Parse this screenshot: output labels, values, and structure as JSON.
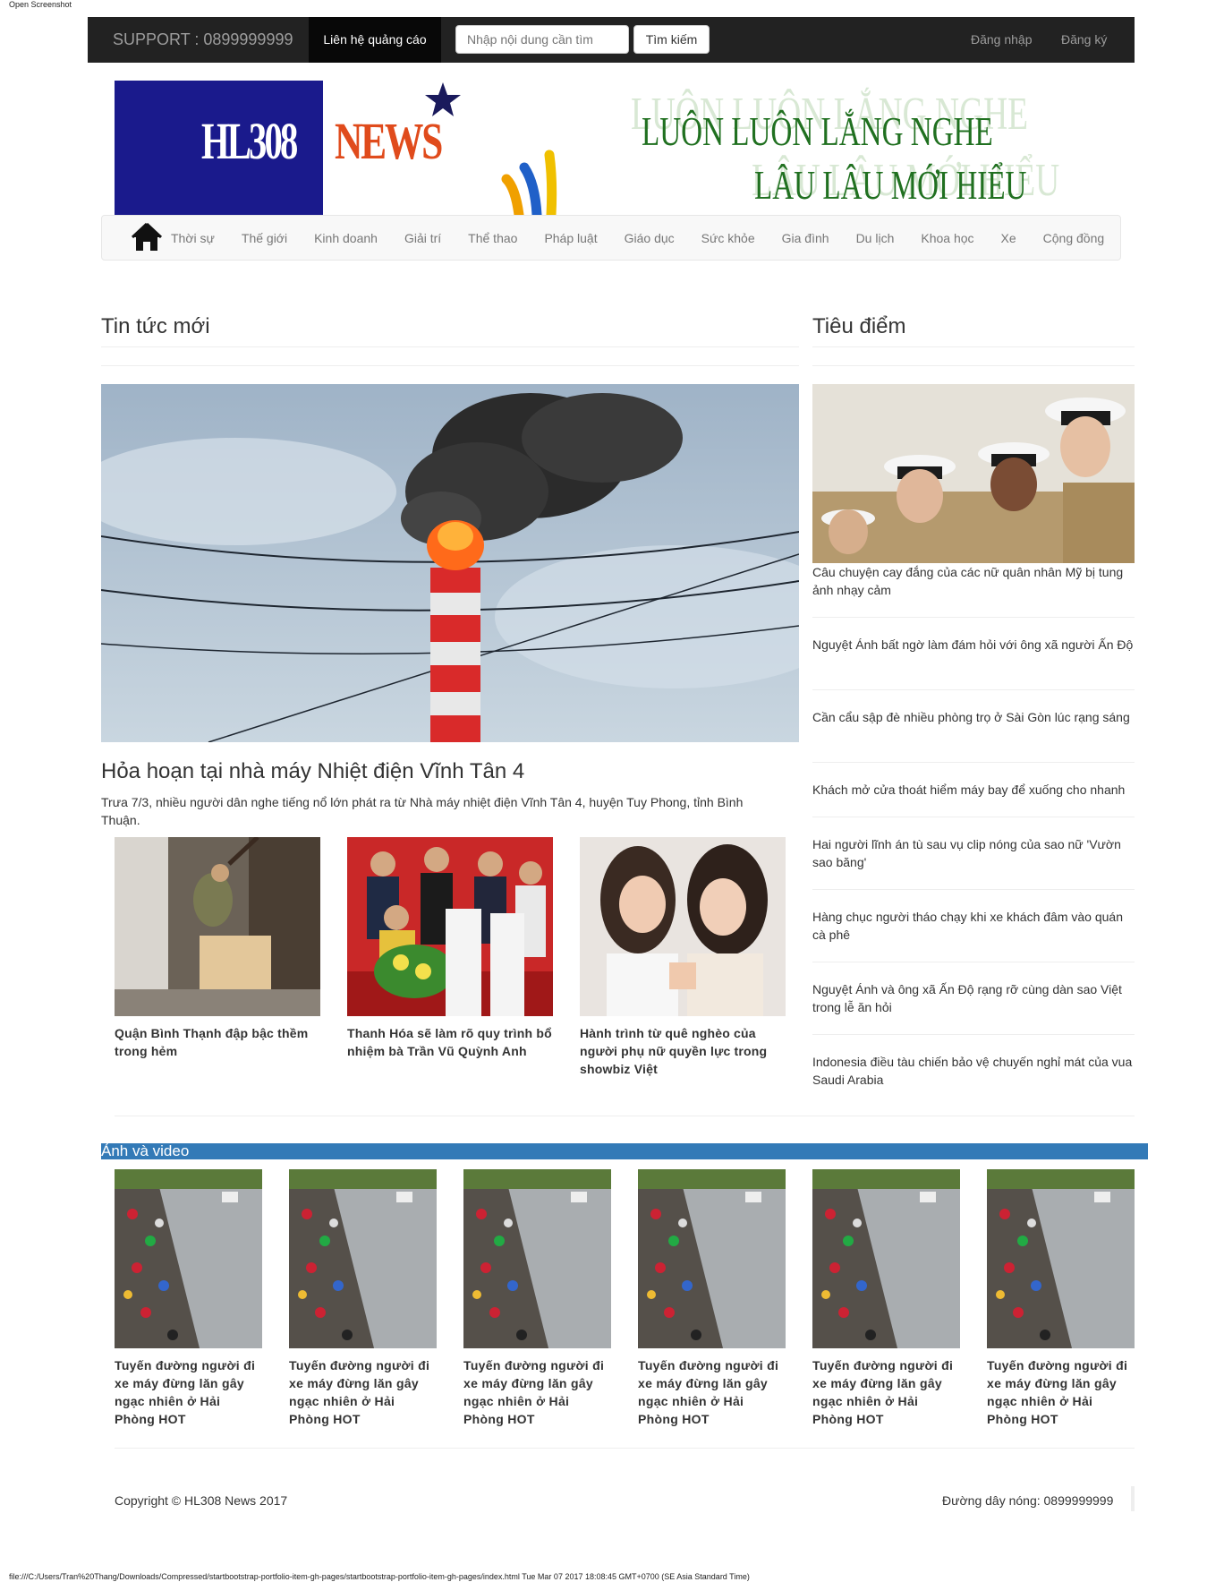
{
  "window": {
    "label": "Open Screenshot"
  },
  "topbar": {
    "support": "SUPPORT : 0899999999",
    "ads_label": "Liên hệ quảng cáo",
    "search_placeholder": "Nhập nội dung cần tìm",
    "search_button": "Tìm kiếm",
    "login": "Đăng nhập",
    "register": "Đăng ký"
  },
  "banner": {
    "logo_hl": "HL308",
    "logo_news": "NEWS",
    "slogan_line1": "LUÔN LUÔN LẮNG NGHE",
    "slogan_line2": "LÂU LÂU MỚI HIỂU"
  },
  "nav": {
    "home_icon": "home-icon",
    "items": [
      "Thời sự",
      "Thế giới",
      "Kinh doanh",
      "Giải trí",
      "Thể thao",
      "Pháp luật",
      "Giáo dục",
      "Sức khỏe",
      "Gia đình",
      "Du lịch",
      "Khoa học",
      "Xe",
      "Cộng đồng"
    ]
  },
  "main": {
    "heading": "Tin tức mới",
    "featured_title": "Hỏa hoạn tại nhà máy Nhiệt điện Vĩnh Tân 4",
    "featured_summary": "Trưa 7/3, nhiều người dân nghe tiếng nổ lớn phát ra từ Nhà máy nhiệt điện Vĩnh Tân 4, huyện Tuy Phong, tỉnh Bình Thuận.",
    "thumbs": [
      {
        "caption": "Quận Bình Thạnh đập bậc thềm trong hẻm"
      },
      {
        "caption": "Thanh Hóa sẽ làm rõ quy trình bổ nhiệm bà Trần Vũ Quỳnh Anh"
      },
      {
        "caption": "Hành trình từ quê nghèo của người phụ nữ quyền lực trong showbiz Việt"
      }
    ]
  },
  "sidebar": {
    "heading": "Tiêu điểm",
    "items": [
      "Câu chuyện cay đắng của các nữ quân nhân Mỹ bị tung ảnh nhạy cảm",
      "Nguyệt Ánh bất ngờ làm đám hỏi với ông xã người Ấn Độ",
      "Cần cẩu sập đè nhiều phòng trọ ở Sài Gòn lúc rạng sáng",
      "Khách mở cửa thoát hiểm máy bay để xuống cho nhanh",
      "Hai người lĩnh án tù sau vụ clip nóng của sao nữ 'Vườn sao băng'",
      "Hàng chục người tháo chạy khi xe khách đâm vào quán cà phê",
      "Nguyệt Ánh và ông xã Ấn Độ rạng rỡ cùng dàn sao Việt trong lễ ăn hỏi",
      "Indonesia điều tàu chiến bảo vệ chuyến nghỉ mát của vua Saudi Arabia"
    ]
  },
  "photo_video": {
    "heading": "Ảnh và video",
    "items": [
      {
        "caption": "Tuyến đường người đi xe máy đừng lăn gây ngạc nhiên ở Hải Phòng HOT"
      },
      {
        "caption": "Tuyến đường người đi xe máy đừng lăn gây ngạc nhiên ở Hải Phòng HOT"
      },
      {
        "caption": "Tuyến đường người đi xe máy đừng lăn gây ngạc nhiên ở Hải Phòng HOT"
      },
      {
        "caption": "Tuyến đường người đi xe máy đừng lăn gây ngạc nhiên ở Hải Phòng HOT"
      },
      {
        "caption": "Tuyến đường người đi xe máy đừng lăn gây ngạc nhiên ở Hải Phòng HOT"
      },
      {
        "caption": "Tuyến đường người đi xe máy đừng lăn gây ngạc nhiên ở Hải Phòng HOT"
      }
    ]
  },
  "footer": {
    "copyright": "Copyright © HL308 News 2017",
    "hotline": "Đường dây nóng: 0899999999"
  },
  "status_bar": "file:///C:/Users/Tran%20Thang/Downloads/Compressed/startbootstrap-portfolio-item-gh-pages/startbootstrap-portfolio-item-gh-pages/index.html Tue Mar 07 2017 18:08:45 GMT+0700 (SE Asia Standard Time)",
  "colors": {
    "topbar_bg": "#222222",
    "accent_blue": "#337ab7",
    "slogan_green": "#207020",
    "logo_blue": "#1a1a8c",
    "logo_orange": "#e04b1c"
  }
}
